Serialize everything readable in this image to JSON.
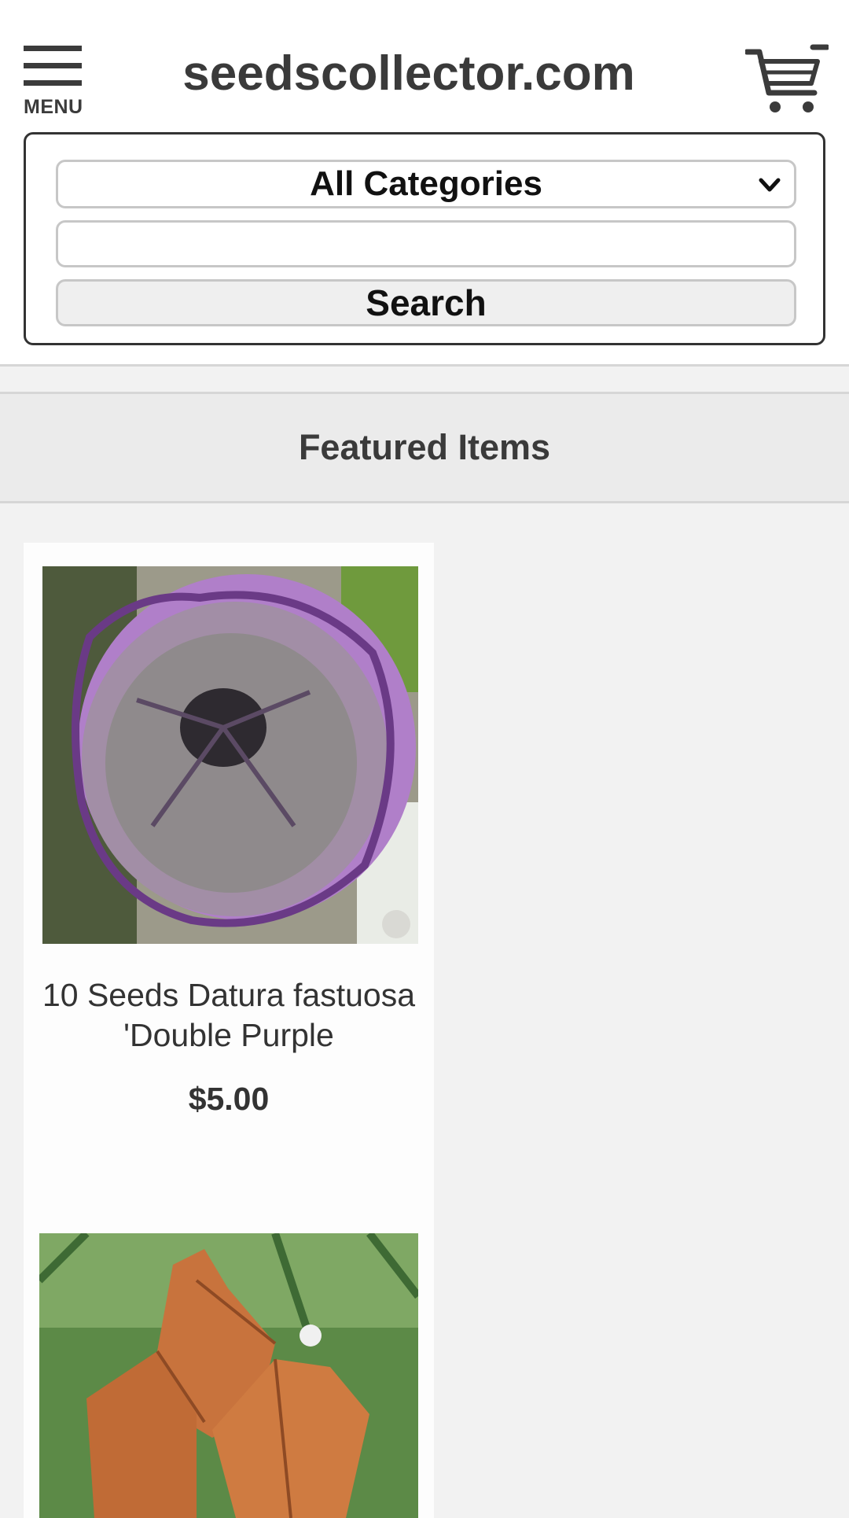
{
  "header": {
    "menu_label": "MENU",
    "site_title": "seedscollector.com",
    "cart_icon": "shopping-cart-icon"
  },
  "search": {
    "category_selected": "All Categories",
    "query_value": "",
    "button_label": "Search"
  },
  "featured": {
    "title": "Featured Items",
    "products": [
      {
        "name": "10 Seeds Datura fastuosa 'Double Purple",
        "price": "$5.00",
        "image": "purple datura flower"
      },
      {
        "image": "orange seed pods"
      }
    ]
  }
}
